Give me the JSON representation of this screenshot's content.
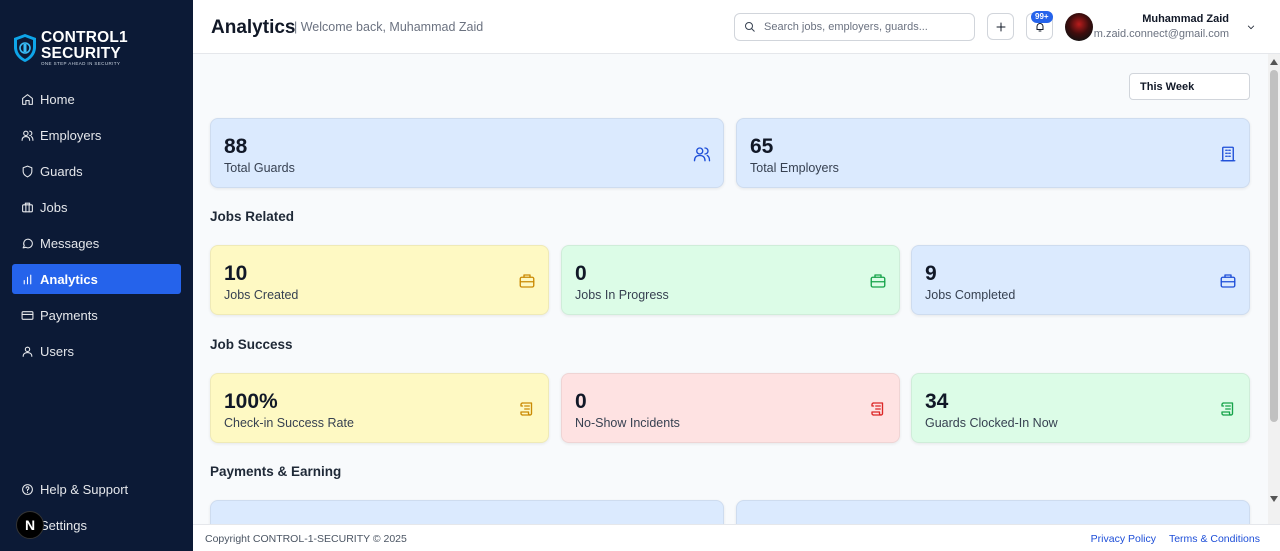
{
  "brand": {
    "line1": "CONTROL1",
    "line2": "SECURITY",
    "tagline": "ONE STEP AHEAD IN SECURITY"
  },
  "sidebar": {
    "items": [
      {
        "label": "Home",
        "icon": "home-icon"
      },
      {
        "label": "Employers",
        "icon": "users-icon"
      },
      {
        "label": "Guards",
        "icon": "shield-icon"
      },
      {
        "label": "Jobs",
        "icon": "briefcase-icon"
      },
      {
        "label": "Messages",
        "icon": "message-icon"
      },
      {
        "label": "Analytics",
        "icon": "bar-chart-icon",
        "active": true
      },
      {
        "label": "Payments",
        "icon": "credit-card-icon"
      },
      {
        "label": "Users",
        "icon": "user-icon"
      }
    ],
    "bottom": [
      {
        "label": "Help & Support",
        "icon": "help-circle-icon"
      },
      {
        "label": "Settings",
        "icon": "gear-icon"
      }
    ],
    "dev_badge": "N"
  },
  "header": {
    "title": "Analytics",
    "welcome": "| Welcome back, Muhammad Zaid",
    "search_placeholder": "Search jobs, employers, guards...",
    "notifications_count": "99+",
    "user_name": "Muhammad Zaid",
    "user_email": "m.zaid.connect@gmail.com"
  },
  "filter": {
    "selected": "This Week"
  },
  "summary": [
    {
      "value": "88",
      "label": "Total Guards",
      "color": "#dbeafe",
      "icon": "users-icon"
    },
    {
      "value": "65",
      "label": "Total Employers",
      "color": "#dbeafe",
      "icon": "building-icon"
    }
  ],
  "sections": {
    "jobs_related": "Jobs Related",
    "job_success": "Job Success",
    "payments": "Payments & Earning"
  },
  "jobs": [
    {
      "value": "10",
      "label": "Jobs Created",
      "color": "#fef9c3",
      "icon": "briefcase-icon"
    },
    {
      "value": "0",
      "label": "Jobs In Progress",
      "color": "#dcfce7",
      "icon": "briefcase-icon"
    },
    {
      "value": "9",
      "label": "Jobs Completed",
      "color": "#dbeafe",
      "icon": "briefcase-icon"
    }
  ],
  "success": [
    {
      "value": "100%",
      "label": "Check-in Success Rate",
      "color": "#fef9c3",
      "icon": "scroll-icon"
    },
    {
      "value": "0",
      "label": "No-Show Incidents",
      "color": "#fee2e2",
      "icon": "scroll-icon"
    },
    {
      "value": "34",
      "label": "Guards Clocked-In Now",
      "color": "#dcfce7",
      "icon": "scroll-icon"
    }
  ],
  "footer": {
    "copyright": "Copyright CONTROL-1-SECURITY © 2025",
    "privacy": "Privacy Policy",
    "terms": "Terms & Conditions"
  },
  "colors": {
    "sidebar_bg": "#0c1a36",
    "accent": "#2563eb"
  }
}
